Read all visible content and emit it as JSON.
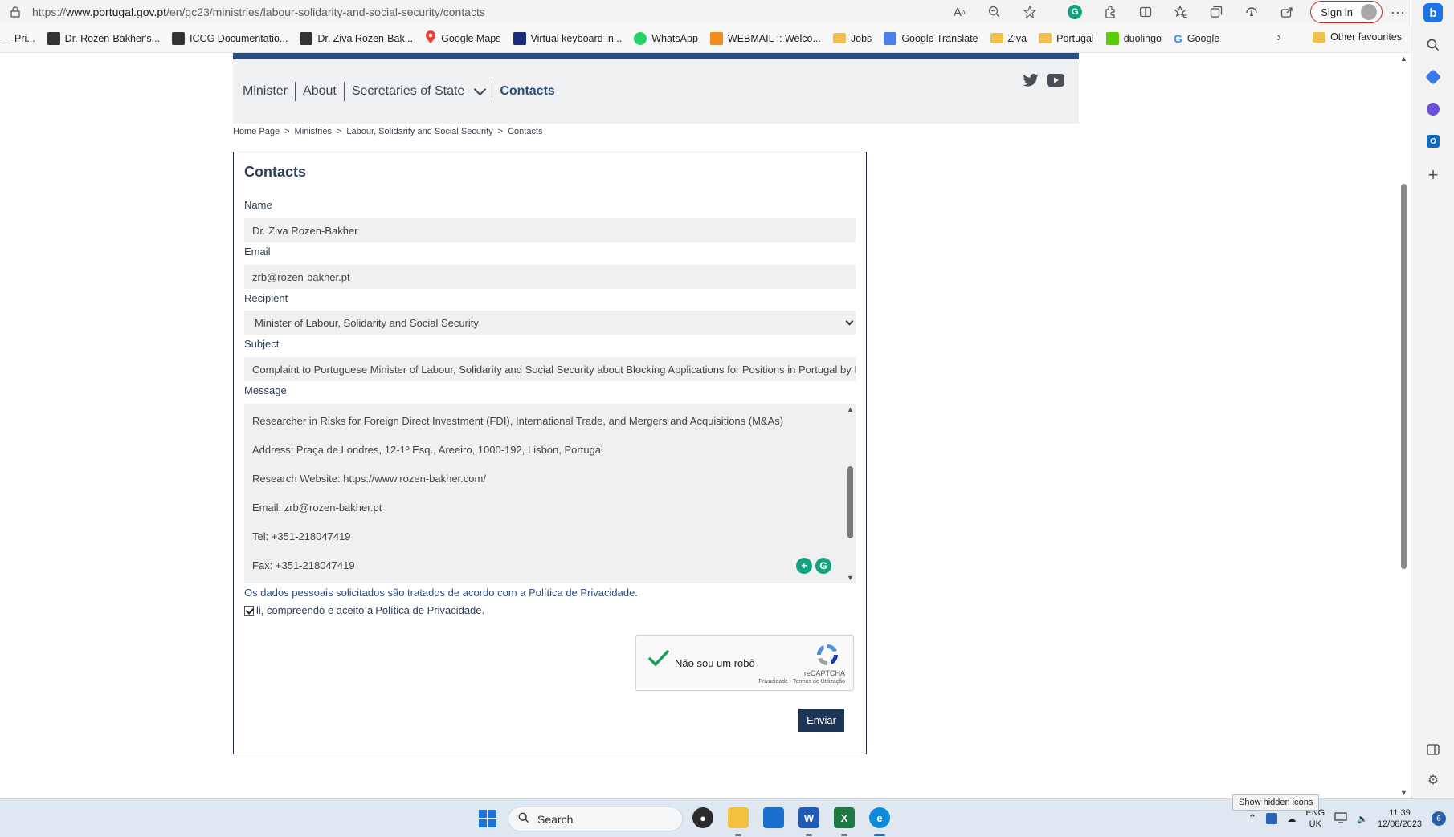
{
  "browser": {
    "url_prefix": "https://",
    "url_domain": "www.portugal.gov.pt",
    "url_path": "/en/gc23/ministries/labour-solidarity-and-social-security/contacts",
    "sign_in": "Sign in",
    "favourites": [
      {
        "label": "— Pri...",
        "icon": "dash"
      },
      {
        "label": "Dr. Rozen-Bakher's...",
        "icon": "cube"
      },
      {
        "label": "ICCG Documentatio...",
        "icon": "cube"
      },
      {
        "label": "Dr. Ziva Rozen-Bak...",
        "icon": "cube"
      },
      {
        "label": "Google Maps",
        "icon": "maps-pin"
      },
      {
        "label": "Virtual keyboard in...",
        "icon": "keyboard"
      },
      {
        "label": "WhatsApp",
        "icon": "whatsapp"
      },
      {
        "label": "WEBMAIL :: Welco...",
        "icon": "webmail"
      },
      {
        "label": "Jobs",
        "icon": "folder"
      },
      {
        "label": "Google Translate",
        "icon": "translate"
      },
      {
        "label": "Ziva",
        "icon": "folder"
      },
      {
        "label": "Portugal",
        "icon": "folder"
      },
      {
        "label": "duolingo",
        "icon": "duolingo"
      },
      {
        "label": "Google",
        "icon": "google"
      }
    ],
    "other_favourites": "Other favourites"
  },
  "site": {
    "nav": [
      {
        "label": "Minister"
      },
      {
        "label": "About"
      },
      {
        "label": "Secretaries of State"
      },
      {
        "label": "Contacts"
      }
    ],
    "breadcrumb": [
      "Home Page",
      "Ministries",
      "Labour, Solidarity and Social Security",
      "Contacts"
    ],
    "breadcrumb_sep": ">"
  },
  "form": {
    "title": "Contacts",
    "name_label": "Name",
    "name_value": "Dr. Ziva Rozen-Bakher",
    "email_label": "Email",
    "email_value": "zrb@rozen-bakher.pt",
    "recipient_label": "Recipient",
    "recipient_value": "Minister of Labour, Solidarity and Social Security",
    "subject_label": "Subject",
    "subject_value": "Complaint to Portuguese Minister of Labour, Solidarity and Social Security about Blocking Applications for Positions in Portugal by ICCG",
    "message_label": "Message",
    "message_lines": [
      "Researcher in Risks for Foreign Direct Investment (FDI), International Trade, and Mergers and Acquisitions (M&As)",
      "Address: Praça de Londres, 12-1º Esq., Areeiro, 1000-192, Lisbon, Portugal",
      "Research Website: https://www.rozen-bakher.com/",
      "Email: zrb@rozen-bakher.pt",
      "Tel: +351-218047419",
      "Fax: +351-218047419"
    ],
    "privacy_note": "Os dados pessoais solicitados são tratados de acordo com a Política de Privacidade.",
    "consent_text": "li, compreendo e aceito a ",
    "consent_link": "Política de Privacidade.",
    "consent_checked": true,
    "captcha_label": "Não sou um robô",
    "captcha_brand": "reCAPTCHA",
    "captcha_terms": "Privacidade - Termos de Utilização",
    "submit": "Enviar"
  },
  "taskbar": {
    "search_placeholder": "Search",
    "lang_top": "ENG",
    "lang_bottom": "UK",
    "time": "11:39",
    "date": "12/08/2023",
    "notifications": "6",
    "tooltip": "Show hidden icons"
  },
  "colors": {
    "brand_navy": "#2c4d7c",
    "button_navy": "#1f3556",
    "field_bg": "#eef0f1"
  }
}
